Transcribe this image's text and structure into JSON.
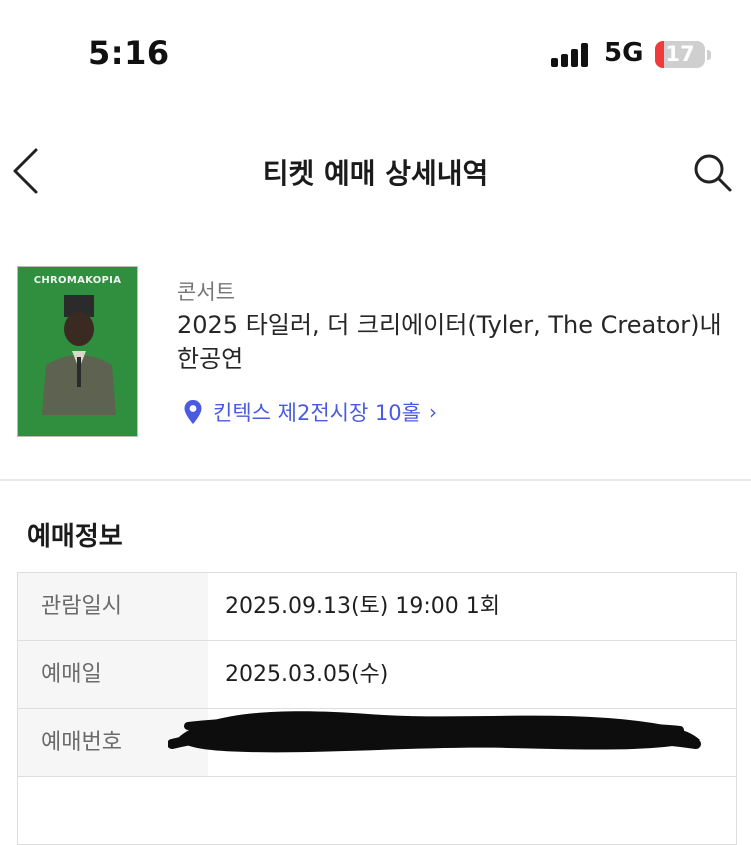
{
  "status_bar": {
    "time": "5:16",
    "network": "5G",
    "battery": "17",
    "battery_level": 0.17,
    "colors": {
      "battery_low": "#ef3b3b"
    }
  },
  "nav": {
    "title": "티켓 예매 상세내역",
    "back_icon": "chevron-left-icon",
    "search_icon": "search-icon"
  },
  "event": {
    "category": "콘서트",
    "title": "2025 타일러, 더 크리에이터(Tyler, The Creator)내한공연",
    "venue": "킨텍스 제2전시장 10홀",
    "venue_chevron": "›",
    "poster": {
      "brand": "CHROMAKOPIA",
      "background_color": "#2f8f3e"
    },
    "colors": {
      "link": "#4a5bdf"
    }
  },
  "reservation": {
    "section_title": "예매정보",
    "rows": [
      {
        "label": "관람일시",
        "value": "2025.09.13(토) 19:00 1회"
      },
      {
        "label": "예매일",
        "value": "2025.03.05(수)"
      },
      {
        "label": "예매번호",
        "value": ""
      }
    ]
  }
}
